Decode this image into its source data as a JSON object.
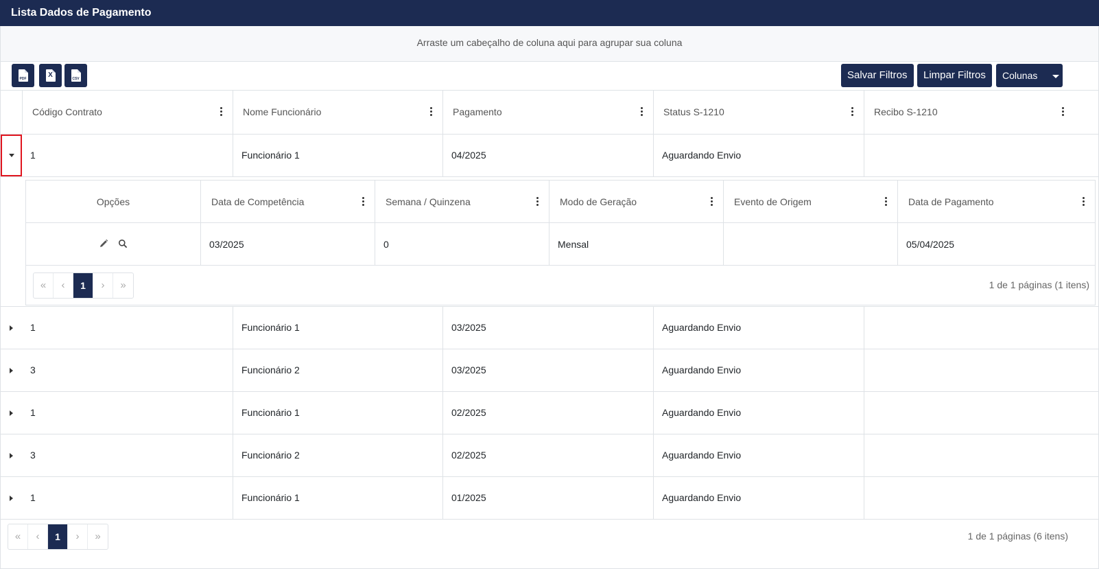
{
  "window": {
    "title": "Lista Dados de Pagamento"
  },
  "group_panel": {
    "text": "Arraste um cabeçalho de coluna aqui para agrupar sua coluna"
  },
  "toolbar": {
    "pdf_icon": "pdf-file-icon",
    "pdf_tag": "PDF",
    "excel_icon": "excel-file-icon",
    "excel_tag": "X",
    "csv_icon": "csv-file-icon",
    "csv_tag": "CSV",
    "save_filters": "Salvar Filtros",
    "clear_filters": "Limpar Filtros",
    "columns": "Colunas"
  },
  "columns": [
    "Código Contrato",
    "Nome Funcionário",
    "Pagamento",
    "Status S-1210",
    "Recibo S-1210"
  ],
  "rows": [
    {
      "codigo": "1",
      "nome": "Funcionário 1",
      "pagamento": "04/2025",
      "status": "Aguardando Envio",
      "recibo": ""
    },
    {
      "codigo": "1",
      "nome": "Funcionário 1",
      "pagamento": "03/2025",
      "status": "Aguardando Envio",
      "recibo": ""
    },
    {
      "codigo": "3",
      "nome": "Funcionário 2",
      "pagamento": "03/2025",
      "status": "Aguardando Envio",
      "recibo": ""
    },
    {
      "codigo": "1",
      "nome": "Funcionário 1",
      "pagamento": "02/2025",
      "status": "Aguardando Envio",
      "recibo": ""
    },
    {
      "codigo": "3",
      "nome": "Funcionário 2",
      "pagamento": "02/2025",
      "status": "Aguardando Envio",
      "recibo": ""
    },
    {
      "codigo": "1",
      "nome": "Funcionário 1",
      "pagamento": "01/2025",
      "status": "Aguardando Envio",
      "recibo": ""
    }
  ],
  "detail": {
    "columns": [
      "Opções",
      "Data de Competência",
      "Semana / Quinzena",
      "Modo de Geração",
      "Evento de Origem",
      "Data de Pagamento"
    ],
    "rows": [
      {
        "competencia": "03/2025",
        "semana": "0",
        "modo": "Mensal",
        "evento": "",
        "data_pagamento": "05/04/2025",
        "edit_icon": "pencil-icon",
        "view_icon": "search-icon"
      }
    ],
    "pager": {
      "first": "«",
      "prev": "‹",
      "page": "1",
      "next": "›",
      "last": "»",
      "info": "1 de 1 páginas (1 itens)"
    }
  },
  "pager": {
    "first": "«",
    "prev": "‹",
    "page": "1",
    "next": "›",
    "last": "»",
    "info": "1 de 1 páginas (6 itens)"
  },
  "colors": {
    "primary": "#1c2b52",
    "highlight": "#e0141e",
    "border": "#dee2e6"
  }
}
